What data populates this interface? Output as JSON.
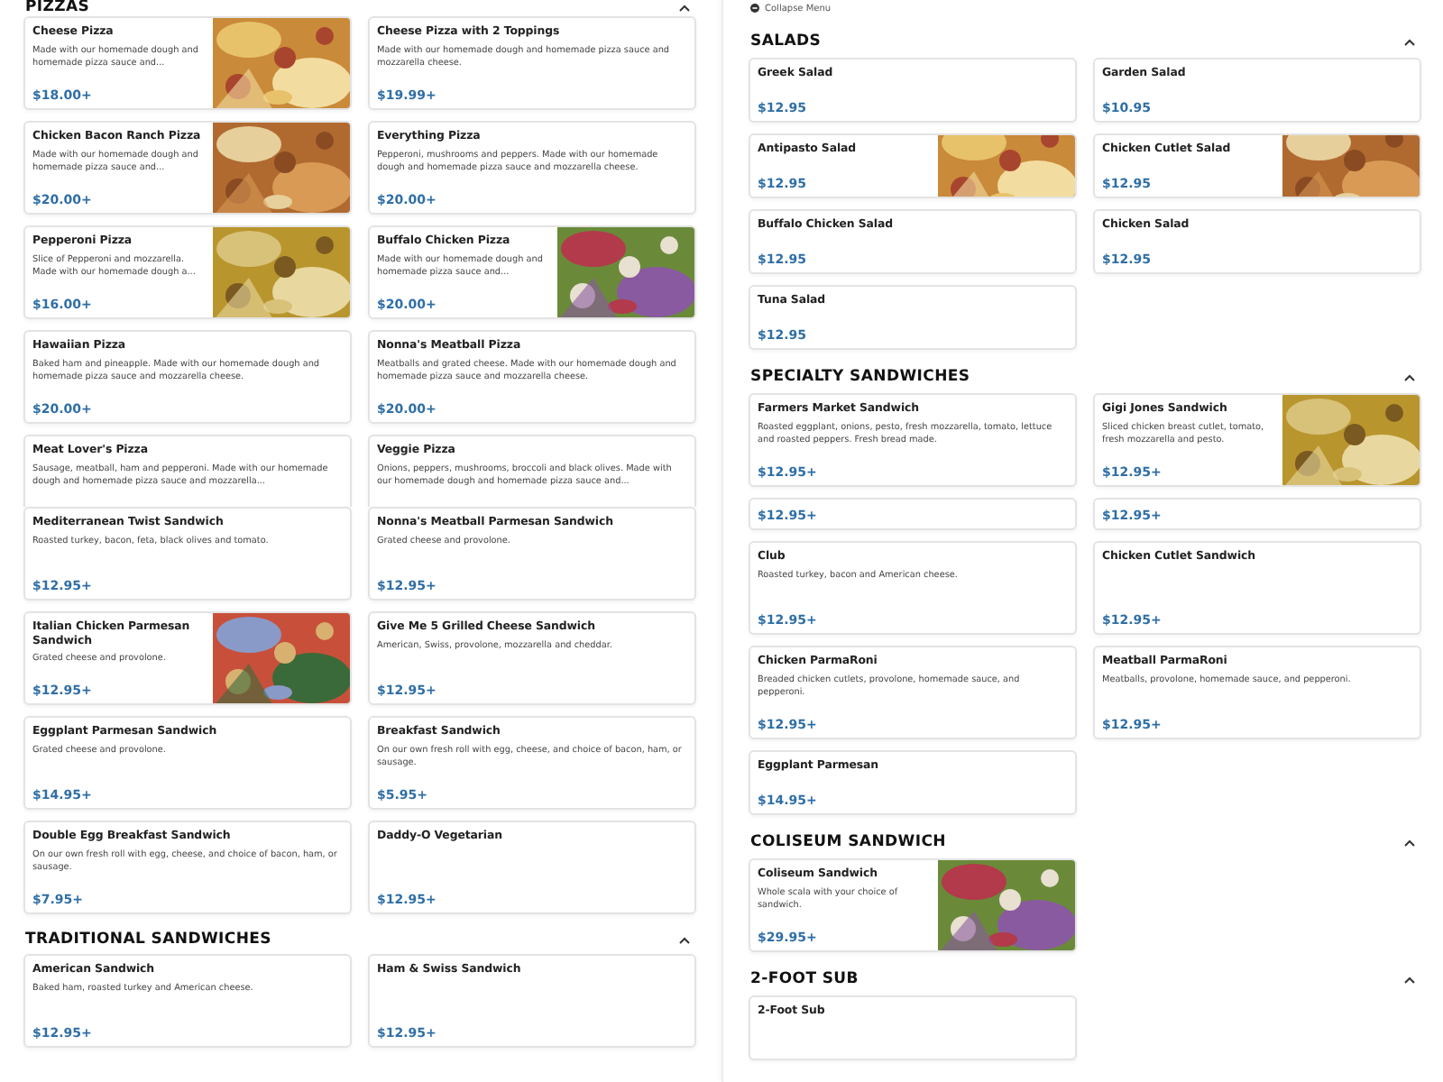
{
  "left_panel": {
    "sections": [
      {
        "title": "PIZZAS",
        "expanded": true,
        "items": [
          {
            "name": "Cheese Pizza",
            "description": "Made with our homemade dough and homemade pizza sauce and...",
            "price": "$18.00+"
          },
          {
            "name": "Cheese Pizza with 2 Toppings",
            "description": "Made with our homemade dough and homemade pizza sauce and mozzarella cheese.",
            "price": "$19.99+"
          },
          {
            "name": "Chicken Bacon Ranch Pizza",
            "description": "Made with our homemade dough and homemade pizza sauce and...",
            "price": "$20.00+"
          },
          {
            "name": "Everything Pizza",
            "description": "Pepperoni, mushrooms and peppers. Made with our homemade dough and homemade pizza sauce and mozzarella cheese.",
            "price": "$20.00+"
          },
          {
            "name": "Pepperoni Pizza",
            "description": "Slice of Pepperoni and mozzarella. Made with our homemade dough a...",
            "price": "$16.00+"
          },
          {
            "name": "Buffalo Chicken Pizza",
            "description": "Made with our homemade dough and homemade pizza sauce and...",
            "price": "$20.00+"
          },
          {
            "name": "Hawaiian Pizza",
            "description": "Baked ham and pineapple. Made with our homemade dough and homemade pizza sauce and mozzarella cheese.",
            "price": "$20.00+"
          },
          {
            "name": "Nonna's Meatball Pizza",
            "description": "Meatballs and grated cheese. Made with our homemade dough and homemade pizza sauce and mozzarella cheese.",
            "price": "$20.00+"
          },
          {
            "name": "Meat Lover's Pizza",
            "description": "Sausage, meatball, ham and pepperoni. Made with our homemade dough and homemade pizza sauce and mozzarella..."
          },
          {
            "name": "Veggie Pizza",
            "description": "Onions, peppers, mushrooms, broccoli and black olives. Made with our homemade dough and homemade pizza sauce and..."
          }
        ]
      },
      {
        "items": [
          {
            "name": "Mediterranean Twist Sandwich",
            "description": "Roasted turkey, bacon, feta, black olives and tomato.",
            "price": "$12.95+"
          },
          {
            "name": "Nonna's Meatball Parmesan Sandwich",
            "description": "Grated cheese and provolone.",
            "price": "$12.95+"
          },
          {
            "name": "Italian Chicken Parmesan Sandwich",
            "description": "Grated cheese and provolone.",
            "price": "$12.95+"
          },
          {
            "name": "Give Me 5 Grilled Cheese Sandwich",
            "description": "American, Swiss, provolone, mozzarella and cheddar.",
            "price": "$12.95+"
          },
          {
            "name": "Eggplant Parmesan Sandwich",
            "description": "Grated cheese and provolone.",
            "price": "$14.95+"
          },
          {
            "name": "Breakfast Sandwich",
            "description": "On our own fresh roll with egg, cheese, and choice of bacon, ham, or sausage.",
            "price": "$5.95+"
          },
          {
            "name": "Double Egg Breakfast Sandwich",
            "description": "On our own fresh roll with egg, cheese, and choice of bacon, ham, or sausage.",
            "price": "$7.95+"
          },
          {
            "name": "Daddy-O Vegetarian",
            "price": "$12.95+"
          }
        ]
      },
      {
        "title": "TRADITIONAL SANDWICHES",
        "expanded": true,
        "items": [
          {
            "name": "American Sandwich",
            "description": "Baked ham, roasted turkey and American cheese.",
            "price": "$12.95+"
          },
          {
            "name": "Ham & Swiss Sandwich",
            "price": "$12.95+"
          }
        ]
      }
    ]
  },
  "right_panel": {
    "collapse_link": "Collapse Menu",
    "sections": [
      {
        "title": "SALADS",
        "expanded": true,
        "items": [
          {
            "name": "Greek Salad",
            "price": "$12.95"
          },
          {
            "name": "Garden Salad",
            "price": "$10.95"
          },
          {
            "name": "Antipasto Salad",
            "price": "$12.95"
          },
          {
            "name": "Chicken Cutlet Salad",
            "price": "$12.95"
          },
          {
            "name": "Buffalo Chicken Salad",
            "price": "$12.95"
          },
          {
            "name": "Chicken Salad",
            "price": "$12.95"
          },
          {
            "name": "Tuna Salad",
            "price": "$12.95"
          }
        ]
      },
      {
        "title": "SPECIALTY SANDWICHES",
        "expanded": true,
        "items": [
          {
            "name": "Farmers Market Sandwich",
            "description": "Roasted eggplant, onions, pesto, fresh mozzarella, tomato, lettuce and roasted peppers. Fresh bread made.",
            "price": "$12.95+"
          },
          {
            "name": "Gigi Jones Sandwich",
            "description": "Sliced chicken breast cutlet, tomato, fresh mozzarella and pesto.",
            "price": "$12.95+"
          },
          {
            "price": "$12.95+"
          },
          {
            "price": "$12.95+"
          },
          {
            "name": "Club",
            "description": "Roasted turkey, bacon and American cheese.",
            "price": "$12.95+"
          },
          {
            "name": "Chicken Cutlet Sandwich",
            "price": "$12.95+"
          },
          {
            "name": "Chicken ParmaRoni",
            "description": "Breaded chicken cutlets, provolone, homemade sauce, and pepperoni.",
            "price": "$12.95+"
          },
          {
            "name": "Meatball ParmaRoni",
            "description": "Meatballs, provolone, homemade sauce, and pepperoni.",
            "price": "$12.95+"
          },
          {
            "name": "Eggplant Parmesan",
            "price": "$14.95+"
          }
        ]
      },
      {
        "title": "COLISEUM SANDWICH",
        "expanded": true,
        "items": [
          {
            "name": "Coliseum Sandwich",
            "description": "Whole scala with your choice of sandwich.",
            "price": "$29.95+"
          }
        ]
      },
      {
        "title": "2-FOOT SUB",
        "expanded": true,
        "items": [
          {
            "name": "2-Foot Sub"
          }
        ]
      }
    ]
  }
}
